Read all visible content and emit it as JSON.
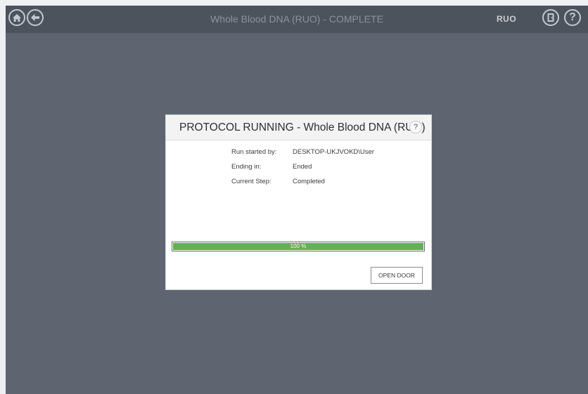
{
  "header": {
    "title": "Whole Blood DNA (RUO) - COMPLETE",
    "badge": "RUO",
    "home_icon": "home-icon",
    "back_icon": "arrow-left-icon",
    "door_icon": "door-icon",
    "help_icon": "help-icon",
    "help_glyph": "?"
  },
  "dialog": {
    "title": "PROTOCOL RUNNING - Whole Blood DNA (RUO)",
    "help_glyph": "?",
    "info": [
      {
        "label": "Run started by:",
        "value": "DESKTOP-UKJVOKD\\User"
      },
      {
        "label": "Ending in:",
        "value": "Ended"
      },
      {
        "label": "Current Step:",
        "value": "Completed"
      }
    ],
    "progress": {
      "value_percent": 100,
      "label": "100 %"
    },
    "open_door_label": "OPEN DOOR"
  },
  "colors": {
    "background": "#5f6570",
    "header": "#4d535d",
    "progress_fill": "#63b24a",
    "dialog": "#ffffff"
  }
}
